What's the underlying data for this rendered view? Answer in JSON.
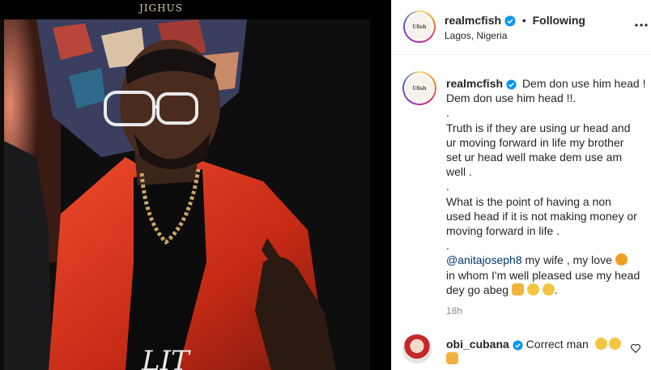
{
  "media": {
    "watermark_text": "JIGHUS",
    "colors": {
      "jacket": "#d8341c",
      "background": "#0c0c0c"
    }
  },
  "header": {
    "username": "realmcfish",
    "separator": "•",
    "follow_status": "Following",
    "location": "Lagos, Nigeria",
    "avatar_text": "Ufish"
  },
  "caption": {
    "username": "realmcfish",
    "line1": "Dem don use him head !",
    "line2": "Dem don use him head !!.",
    "dot1": ".",
    "para1_l1": "Truth is if they are using ur head and",
    "para1_l2": "ur moving forward in life my brother",
    "para1_l3": "set ur head well make dem use am",
    "para1_l4": "well .",
    "dot2": ".",
    "para2_l1": "What is the point of having a non",
    "para2_l2": "used head if it is not making money or",
    "para2_l3": "moving forward in life .",
    "dot3": ".",
    "mention": "@anitajoseph8",
    "para3_l1_rest": " my wife , my love ",
    "para3_l2": "in whom I'm well pleased use my head",
    "para3_l3": "dey go abeg ",
    "para3_end": "."
  },
  "timestamp": "18h",
  "comment": {
    "username": "obi_cubana",
    "text": "Correct man"
  },
  "icons": {
    "verified": "verified-badge-icon",
    "more": "more-options-icon",
    "like": "heart-icon"
  }
}
